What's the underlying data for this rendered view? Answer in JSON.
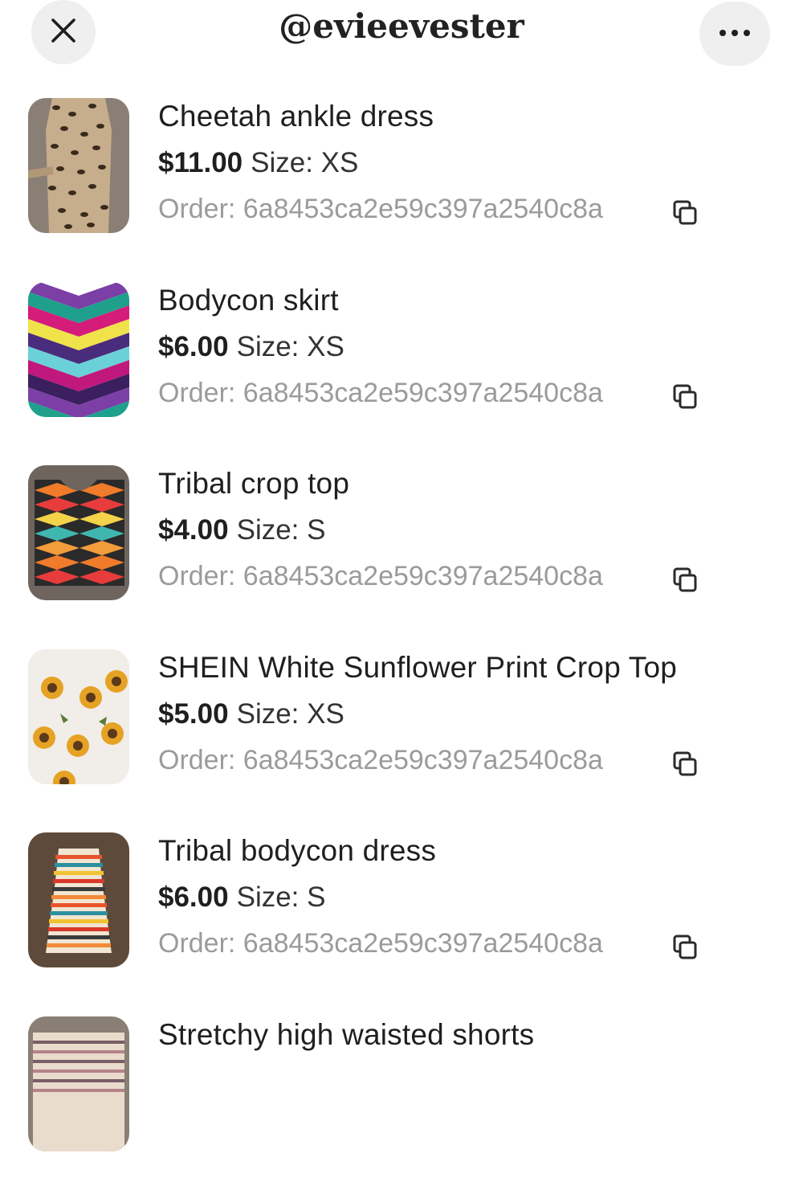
{
  "header": {
    "title": "@evieevester",
    "close_icon": "close-icon",
    "more_icon": "more-horizontal-icon"
  },
  "labels": {
    "size_prefix": "Size:",
    "order_prefix": "Order:"
  },
  "items": [
    {
      "title": "Cheetah ankle dress",
      "price": "$11.00",
      "size": "XS",
      "order": "6a8453ca2e59c397a2540c8a",
      "thumb": "leopard"
    },
    {
      "title": "Bodycon skirt",
      "price": "$6.00",
      "size": "XS",
      "order": "6a8453ca2e59c397a2540c8a",
      "thumb": "chevron"
    },
    {
      "title": "Tribal crop top",
      "price": "$4.00",
      "size": "S",
      "order": "6a8453ca2e59c397a2540c8a",
      "thumb": "tribal-top"
    },
    {
      "title": "SHEIN White Sunflower Print Crop Top",
      "price": "$5.00",
      "size": "XS",
      "order": "6a8453ca2e59c397a2540c8a",
      "thumb": "sunflower"
    },
    {
      "title": "Tribal bodycon dress",
      "price": "$6.00",
      "size": "S",
      "order": "6a8453ca2e59c397a2540c8a",
      "thumb": "tribal-dress"
    },
    {
      "title": "Stretchy high waisted shorts",
      "price": "",
      "size": "",
      "order": "",
      "thumb": "shorts"
    }
  ],
  "colors": {
    "button_bg": "#efefef",
    "text_primary": "#1f1f1f",
    "text_secondary": "#9b9b9b"
  }
}
